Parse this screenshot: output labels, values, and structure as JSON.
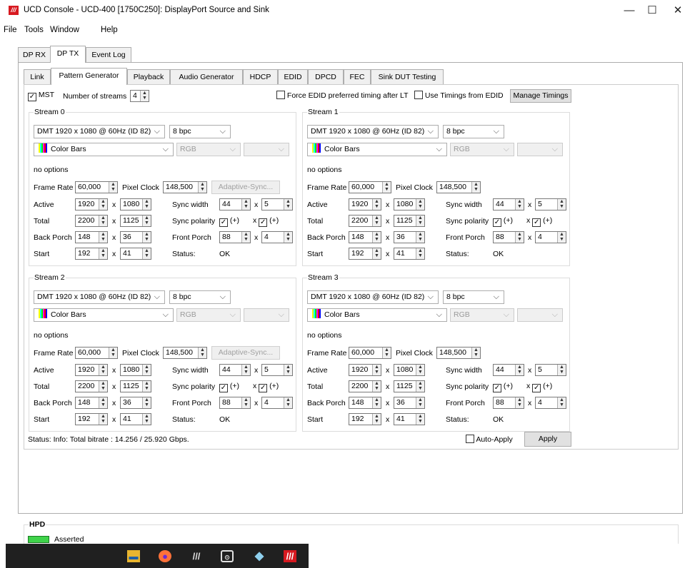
{
  "window": {
    "title": "UCD Console - UCD-400 [1750C250]: DisplayPort Source and Sink",
    "app_icon_text": "///",
    "minimize": "—",
    "maximize": "☐",
    "close": "✕"
  },
  "menu": {
    "file": "File",
    "tools": "Tools",
    "window": "Window",
    "help": "Help"
  },
  "top_tabs": [
    "DP RX",
    "DP TX",
    "Event Log"
  ],
  "sub_tabs": [
    "Link",
    "Pattern Generator",
    "Playback",
    "Audio Generator",
    "HDCP",
    "EDID",
    "DPCD",
    "FEC",
    "Sink DUT Testing"
  ],
  "controls": {
    "mst_label": "MST",
    "streams_label": "Number of streams",
    "streams_value": "4",
    "force_edid_label": "Force EDID preferred timing after LT",
    "use_timings_label": "Use Timings from EDID",
    "manage_timings": "Manage Timings"
  },
  "labels": {
    "no_options": "no options",
    "frame_rate": "Frame Rate",
    "pixel_clock": "Pixel Clock",
    "active": "Active",
    "total": "Total",
    "back_porch": "Back Porch",
    "start": "Start",
    "sync_width": "Sync width",
    "sync_polarity": "Sync polarity",
    "front_porch": "Front Porch",
    "status": "Status:",
    "x": "x",
    "plus": "(+)",
    "adaptive_sync": "Adaptive-Sync..."
  },
  "streams": [
    {
      "title": "Stream 0",
      "timing": "DMT 1920 x 1080 @ 60Hz (ID 82)",
      "bpc": "8 bpc",
      "pattern": "Color Bars",
      "colorspace": "RGB",
      "frame_rate": "60,000",
      "pixel_clock": "148,500",
      "active_h": "1920",
      "active_v": "1080",
      "total_h": "2200",
      "total_v": "1125",
      "bp_h": "148",
      "bp_v": "36",
      "start_h": "192",
      "start_v": "41",
      "sync_w_h": "44",
      "sync_w_v": "5",
      "fp_h": "88",
      "fp_v": "4",
      "status": "OK"
    },
    {
      "title": "Stream 1",
      "timing": "DMT 1920 x 1080 @ 60Hz (ID 82)",
      "bpc": "8 bpc",
      "pattern": "Color Bars",
      "colorspace": "RGB",
      "frame_rate": "60,000",
      "pixel_clock": "148,500",
      "active_h": "1920",
      "active_v": "1080",
      "total_h": "2200",
      "total_v": "1125",
      "bp_h": "148",
      "bp_v": "36",
      "start_h": "192",
      "start_v": "41",
      "sync_w_h": "44",
      "sync_w_v": "5",
      "fp_h": "88",
      "fp_v": "4",
      "status": "OK"
    },
    {
      "title": "Stream 2",
      "timing": "DMT 1920 x 1080 @ 60Hz (ID 82)",
      "bpc": "8 bpc",
      "pattern": "Color Bars",
      "colorspace": "RGB",
      "frame_rate": "60,000",
      "pixel_clock": "148,500",
      "active_h": "1920",
      "active_v": "1080",
      "total_h": "2200",
      "total_v": "1125",
      "bp_h": "148",
      "bp_v": "36",
      "start_h": "192",
      "start_v": "41",
      "sync_w_h": "44",
      "sync_w_v": "5",
      "fp_h": "88",
      "fp_v": "4",
      "status": "OK"
    },
    {
      "title": "Stream 3",
      "timing": "DMT 1920 x 1080 @ 60Hz (ID 82)",
      "bpc": "8 bpc",
      "pattern": "Color Bars",
      "colorspace": "RGB",
      "frame_rate": "60,000",
      "pixel_clock": "148,500",
      "active_h": "1920",
      "active_v": "1080",
      "total_h": "2200",
      "total_v": "1125",
      "bp_h": "148",
      "bp_v": "36",
      "start_h": "192",
      "start_v": "41",
      "sync_w_h": "44",
      "sync_w_v": "5",
      "fp_h": "88",
      "fp_v": "4",
      "status": "OK"
    }
  ],
  "footer": {
    "status_text": "Status:  Info: Total bitrate : 14.256 / 25.920 Gbps.",
    "auto_apply": "Auto-Apply",
    "apply": "Apply"
  },
  "hpd": {
    "title": "HPD",
    "state": "Asserted",
    "indicator_color": "#3fd34a"
  },
  "taskbar": {
    "icons": [
      "file-explorer-icon",
      "firefox-icon",
      "ucd-console-icon",
      "terminal-icon",
      "notepad-icon",
      "ucd-console-active-icon"
    ]
  },
  "colors": {
    "brand_red": "#d71920",
    "taskbar": "#202020"
  }
}
